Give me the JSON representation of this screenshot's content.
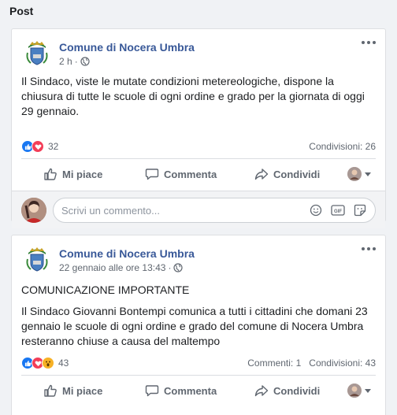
{
  "section": {
    "title": "Post"
  },
  "posts": [
    {
      "page_name": "Comune di Nocera Umbra",
      "time": "2 h",
      "paragraphs": [
        "Il Sindaco, viste le mutate condizioni metereologiche, dispone la chiusura di tutte le scuole di ogni ordine e grado per la giornata di oggi 29 gennaio."
      ],
      "reaction_count": "32",
      "shares": "Condivisioni: 26",
      "comments": "",
      "actions": {
        "like": "Mi piace",
        "comment": "Commenta",
        "share": "Condividi"
      },
      "comment_placeholder": "Scrivi un commento..."
    },
    {
      "page_name": "Comune di Nocera Umbra",
      "time": "22 gennaio alle ore 13:43",
      "paragraphs": [
        "COMUNICAZIONE IMPORTANTE",
        "Il Sindaco Giovanni Bontempi comunica a tutti i cittadini che domani 23 gennaio le scuole di ogni ordine e grado del comune di Nocera Umbra resteranno chiuse a causa del maltempo"
      ],
      "reaction_count": "43",
      "comments": "Commenti: 1",
      "shares": "Condivisioni: 43",
      "actions": {
        "like": "Mi piace",
        "comment": "Commenta",
        "share": "Condividi"
      }
    }
  ],
  "icons": {
    "more": "more-options-icon",
    "globe": "globe-icon",
    "like": "thumbs-up-icon",
    "comment": "speech-bubble-icon",
    "share": "share-arrow-icon",
    "emoji": "emoji-icon",
    "gif": "gif-icon",
    "sticker": "sticker-icon"
  },
  "colors": {
    "link": "#385898",
    "like_blue": "#1877f2",
    "love_red": "#f33e58",
    "wow_yellow": "#f7b125"
  }
}
